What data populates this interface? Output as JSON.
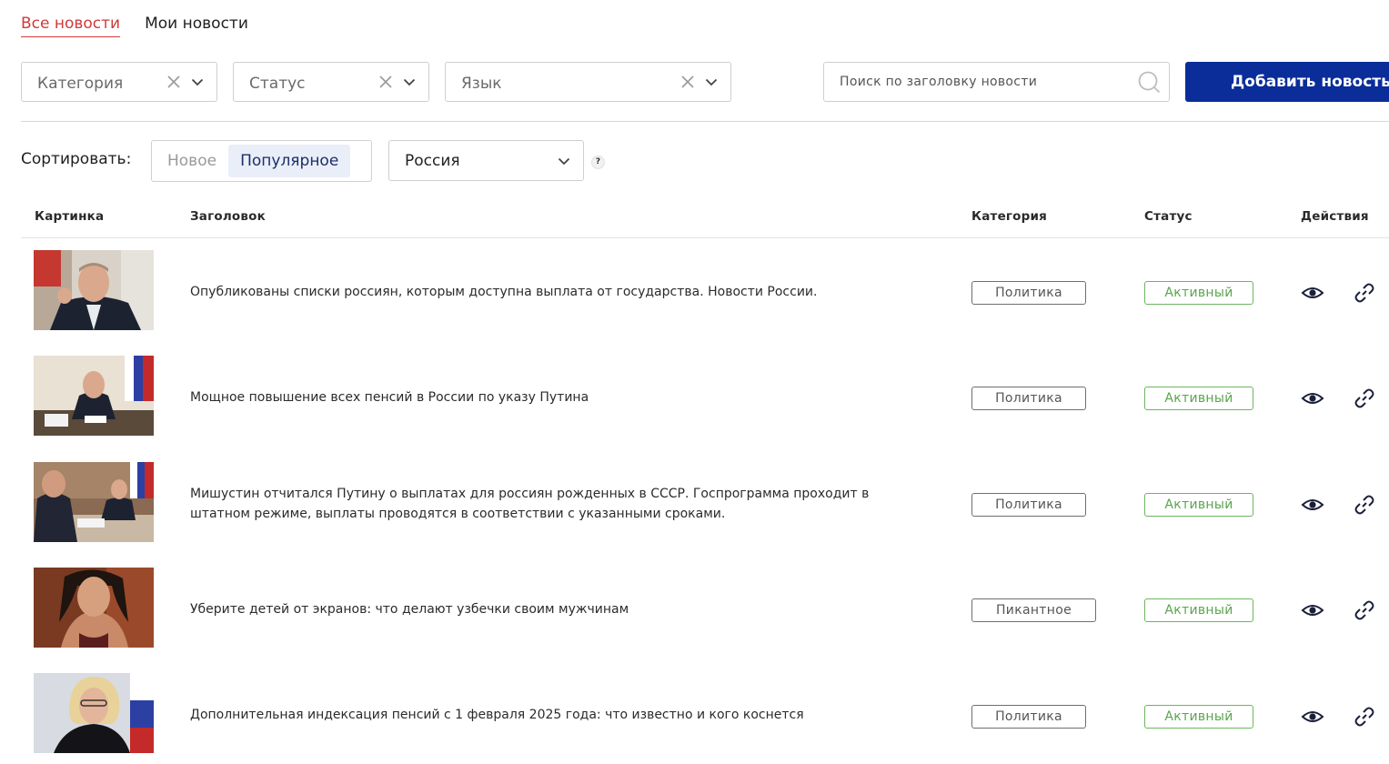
{
  "tabs": [
    {
      "label": "Все новости",
      "active": true
    },
    {
      "label": "Мои новости",
      "active": false
    }
  ],
  "filters": {
    "category_placeholder": "Категория",
    "status_placeholder": "Статус",
    "language_placeholder": "Язык",
    "search_placeholder": "Поиск по заголовку новости",
    "add_button": "Добавить новость"
  },
  "sort": {
    "label": "Сортировать:",
    "options": [
      "Новое",
      "Популярное"
    ],
    "active": "Популярное",
    "region": "Россия",
    "help": "?"
  },
  "table": {
    "headers": {
      "image": "Картинка",
      "title": "Заголовок",
      "category": "Категория",
      "status": "Статус",
      "actions": "Действия"
    },
    "rows": [
      {
        "title": "Опубликованы списки россиян, которым доступна выплата от государства. Новости России.",
        "category": "Политика",
        "status": "Активный",
        "thumb": "man-suit-speaking"
      },
      {
        "title": "Мощное повышение всех пенсий в России по указу Путина",
        "category": "Политика",
        "status": "Активный",
        "thumb": "man-desk-flags"
      },
      {
        "title": "Мишустин отчитался Путину о выплатах для россиян рожденных в СССР. Госпрограмма проходит в штатном режиме, выплаты проводятся в соответствии с указанными сроками.",
        "category": "Политика",
        "status": "Активный",
        "thumb": "meeting-table"
      },
      {
        "title": "Уберите детей от экранов: что делают узбечки своим мужчинам",
        "category": "Пикантное",
        "status": "Активный",
        "thumb": "woman-portrait"
      },
      {
        "title": "Дополнительная индексация пенсий с 1 февраля 2025 года: что известно и кого коснется",
        "category": "Политика",
        "status": "Активный",
        "thumb": "woman-blonde-flag"
      }
    ]
  },
  "colors": {
    "accent_tab": "#d13a3a",
    "primary_button": "#0b2d9a",
    "status_active": "#5aa54d"
  }
}
